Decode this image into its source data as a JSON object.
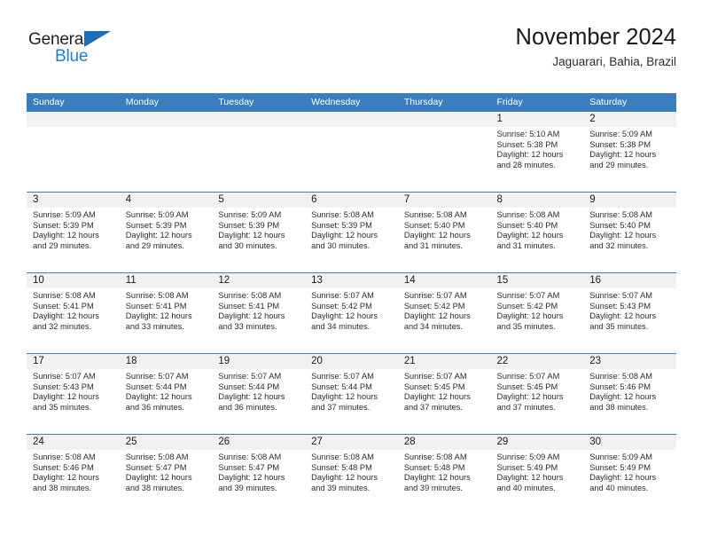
{
  "brand": {
    "name_part1": "General",
    "name_part2": "Blue",
    "triangle_icon": "triangle-icon",
    "color_blue": "#1b7fd4",
    "color_dark": "#231f20"
  },
  "header": {
    "title": "November 2024",
    "subtitle": "Jaguarari, Bahia, Brazil"
  },
  "theme": {
    "header_band": "#3a7ebf",
    "daynum_band": "#f1f1f1",
    "row_rule": "#3a7ebf"
  },
  "weekday_headers": [
    "Sunday",
    "Monday",
    "Tuesday",
    "Wednesday",
    "Thursday",
    "Friday",
    "Saturday"
  ],
  "weeks": [
    [
      {
        "day": "",
        "sunrise": "",
        "sunset": "",
        "daylight_line1": "",
        "daylight_line2": ""
      },
      {
        "day": "",
        "sunrise": "",
        "sunset": "",
        "daylight_line1": "",
        "daylight_line2": ""
      },
      {
        "day": "",
        "sunrise": "",
        "sunset": "",
        "daylight_line1": "",
        "daylight_line2": ""
      },
      {
        "day": "",
        "sunrise": "",
        "sunset": "",
        "daylight_line1": "",
        "daylight_line2": ""
      },
      {
        "day": "",
        "sunrise": "",
        "sunset": "",
        "daylight_line1": "",
        "daylight_line2": ""
      },
      {
        "day": "1",
        "sunrise": "Sunrise: 5:10 AM",
        "sunset": "Sunset: 5:38 PM",
        "daylight_line1": "Daylight: 12 hours",
        "daylight_line2": "and 28 minutes."
      },
      {
        "day": "2",
        "sunrise": "Sunrise: 5:09 AM",
        "sunset": "Sunset: 5:38 PM",
        "daylight_line1": "Daylight: 12 hours",
        "daylight_line2": "and 29 minutes."
      }
    ],
    [
      {
        "day": "3",
        "sunrise": "Sunrise: 5:09 AM",
        "sunset": "Sunset: 5:39 PM",
        "daylight_line1": "Daylight: 12 hours",
        "daylight_line2": "and 29 minutes."
      },
      {
        "day": "4",
        "sunrise": "Sunrise: 5:09 AM",
        "sunset": "Sunset: 5:39 PM",
        "daylight_line1": "Daylight: 12 hours",
        "daylight_line2": "and 29 minutes."
      },
      {
        "day": "5",
        "sunrise": "Sunrise: 5:09 AM",
        "sunset": "Sunset: 5:39 PM",
        "daylight_line1": "Daylight: 12 hours",
        "daylight_line2": "and 30 minutes."
      },
      {
        "day": "6",
        "sunrise": "Sunrise: 5:08 AM",
        "sunset": "Sunset: 5:39 PM",
        "daylight_line1": "Daylight: 12 hours",
        "daylight_line2": "and 30 minutes."
      },
      {
        "day": "7",
        "sunrise": "Sunrise: 5:08 AM",
        "sunset": "Sunset: 5:40 PM",
        "daylight_line1": "Daylight: 12 hours",
        "daylight_line2": "and 31 minutes."
      },
      {
        "day": "8",
        "sunrise": "Sunrise: 5:08 AM",
        "sunset": "Sunset: 5:40 PM",
        "daylight_line1": "Daylight: 12 hours",
        "daylight_line2": "and 31 minutes."
      },
      {
        "day": "9",
        "sunrise": "Sunrise: 5:08 AM",
        "sunset": "Sunset: 5:40 PM",
        "daylight_line1": "Daylight: 12 hours",
        "daylight_line2": "and 32 minutes."
      }
    ],
    [
      {
        "day": "10",
        "sunrise": "Sunrise: 5:08 AM",
        "sunset": "Sunset: 5:41 PM",
        "daylight_line1": "Daylight: 12 hours",
        "daylight_line2": "and 32 minutes."
      },
      {
        "day": "11",
        "sunrise": "Sunrise: 5:08 AM",
        "sunset": "Sunset: 5:41 PM",
        "daylight_line1": "Daylight: 12 hours",
        "daylight_line2": "and 33 minutes."
      },
      {
        "day": "12",
        "sunrise": "Sunrise: 5:08 AM",
        "sunset": "Sunset: 5:41 PM",
        "daylight_line1": "Daylight: 12 hours",
        "daylight_line2": "and 33 minutes."
      },
      {
        "day": "13",
        "sunrise": "Sunrise: 5:07 AM",
        "sunset": "Sunset: 5:42 PM",
        "daylight_line1": "Daylight: 12 hours",
        "daylight_line2": "and 34 minutes."
      },
      {
        "day": "14",
        "sunrise": "Sunrise: 5:07 AM",
        "sunset": "Sunset: 5:42 PM",
        "daylight_line1": "Daylight: 12 hours",
        "daylight_line2": "and 34 minutes."
      },
      {
        "day": "15",
        "sunrise": "Sunrise: 5:07 AM",
        "sunset": "Sunset: 5:42 PM",
        "daylight_line1": "Daylight: 12 hours",
        "daylight_line2": "and 35 minutes."
      },
      {
        "day": "16",
        "sunrise": "Sunrise: 5:07 AM",
        "sunset": "Sunset: 5:43 PM",
        "daylight_line1": "Daylight: 12 hours",
        "daylight_line2": "and 35 minutes."
      }
    ],
    [
      {
        "day": "17",
        "sunrise": "Sunrise: 5:07 AM",
        "sunset": "Sunset: 5:43 PM",
        "daylight_line1": "Daylight: 12 hours",
        "daylight_line2": "and 35 minutes."
      },
      {
        "day": "18",
        "sunrise": "Sunrise: 5:07 AM",
        "sunset": "Sunset: 5:44 PM",
        "daylight_line1": "Daylight: 12 hours",
        "daylight_line2": "and 36 minutes."
      },
      {
        "day": "19",
        "sunrise": "Sunrise: 5:07 AM",
        "sunset": "Sunset: 5:44 PM",
        "daylight_line1": "Daylight: 12 hours",
        "daylight_line2": "and 36 minutes."
      },
      {
        "day": "20",
        "sunrise": "Sunrise: 5:07 AM",
        "sunset": "Sunset: 5:44 PM",
        "daylight_line1": "Daylight: 12 hours",
        "daylight_line2": "and 37 minutes."
      },
      {
        "day": "21",
        "sunrise": "Sunrise: 5:07 AM",
        "sunset": "Sunset: 5:45 PM",
        "daylight_line1": "Daylight: 12 hours",
        "daylight_line2": "and 37 minutes."
      },
      {
        "day": "22",
        "sunrise": "Sunrise: 5:07 AM",
        "sunset": "Sunset: 5:45 PM",
        "daylight_line1": "Daylight: 12 hours",
        "daylight_line2": "and 37 minutes."
      },
      {
        "day": "23",
        "sunrise": "Sunrise: 5:08 AM",
        "sunset": "Sunset: 5:46 PM",
        "daylight_line1": "Daylight: 12 hours",
        "daylight_line2": "and 38 minutes."
      }
    ],
    [
      {
        "day": "24",
        "sunrise": "Sunrise: 5:08 AM",
        "sunset": "Sunset: 5:46 PM",
        "daylight_line1": "Daylight: 12 hours",
        "daylight_line2": "and 38 minutes."
      },
      {
        "day": "25",
        "sunrise": "Sunrise: 5:08 AM",
        "sunset": "Sunset: 5:47 PM",
        "daylight_line1": "Daylight: 12 hours",
        "daylight_line2": "and 38 minutes."
      },
      {
        "day": "26",
        "sunrise": "Sunrise: 5:08 AM",
        "sunset": "Sunset: 5:47 PM",
        "daylight_line1": "Daylight: 12 hours",
        "daylight_line2": "and 39 minutes."
      },
      {
        "day": "27",
        "sunrise": "Sunrise: 5:08 AM",
        "sunset": "Sunset: 5:48 PM",
        "daylight_line1": "Daylight: 12 hours",
        "daylight_line2": "and 39 minutes."
      },
      {
        "day": "28",
        "sunrise": "Sunrise: 5:08 AM",
        "sunset": "Sunset: 5:48 PM",
        "daylight_line1": "Daylight: 12 hours",
        "daylight_line2": "and 39 minutes."
      },
      {
        "day": "29",
        "sunrise": "Sunrise: 5:09 AM",
        "sunset": "Sunset: 5:49 PM",
        "daylight_line1": "Daylight: 12 hours",
        "daylight_line2": "and 40 minutes."
      },
      {
        "day": "30",
        "sunrise": "Sunrise: 5:09 AM",
        "sunset": "Sunset: 5:49 PM",
        "daylight_line1": "Daylight: 12 hours",
        "daylight_line2": "and 40 minutes."
      }
    ]
  ]
}
